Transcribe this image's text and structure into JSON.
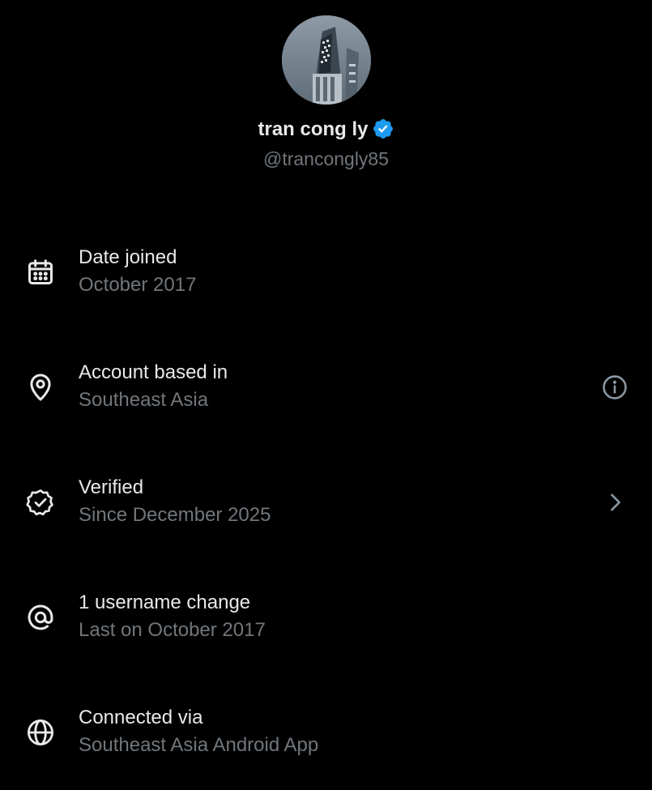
{
  "profile": {
    "display_name": "tran cong ly",
    "handle": "@trancongly85",
    "verified_badge_color": "#1d9bf0"
  },
  "about": [
    {
      "icon": "calendar-icon",
      "label": "Date joined",
      "value": "October 2017"
    },
    {
      "icon": "location-pin-icon",
      "label": "Account based in",
      "value": "Southeast Asia",
      "trailing": "info-icon"
    },
    {
      "icon": "verified-check-icon",
      "label": "Verified",
      "value": "Since December 2025",
      "trailing": "chevron-right-icon"
    },
    {
      "icon": "at-sign-icon",
      "label": "1 username change",
      "value": "Last on October 2017"
    },
    {
      "icon": "globe-icon",
      "label": "Connected via",
      "value": "Southeast Asia Android App"
    }
  ],
  "colors": {
    "background": "#000000",
    "primary_text": "#e7e9ea",
    "secondary_text": "#71767b"
  }
}
